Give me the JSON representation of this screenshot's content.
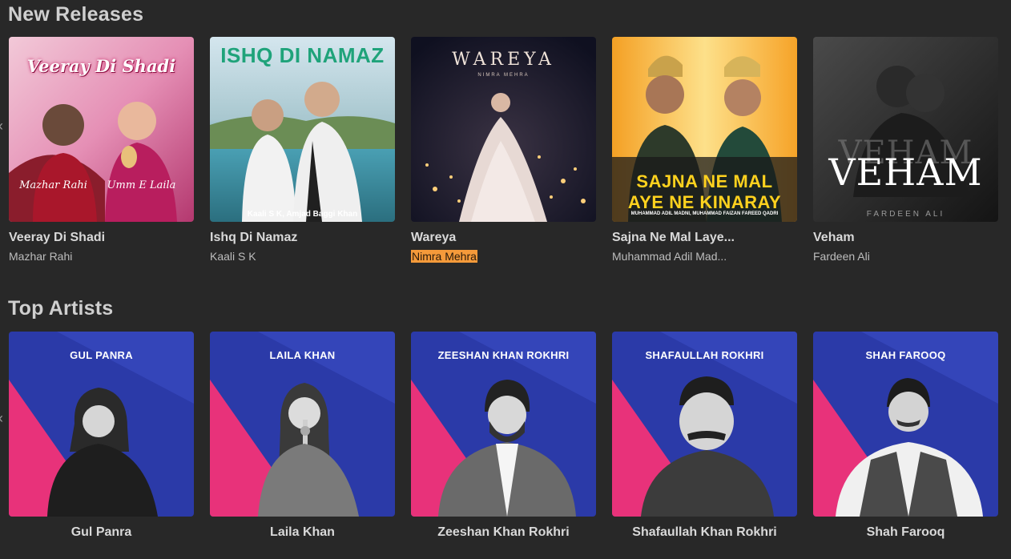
{
  "new_releases": {
    "title": "New Releases",
    "items": [
      {
        "title": "Veeray Di Shadi",
        "artist": "Mazhar Rahi",
        "art_text": "Veeray Di Shadi",
        "art_sub1": "Mazhar Rahi",
        "art_sub2": "Umm E Laila"
      },
      {
        "title": "Ishq Di Namaz",
        "artist": "Kaali S K",
        "art_text": "ISHQ DI NAMAZ",
        "art_sub1": "Kaali S K, Amjad Baggi Khan"
      },
      {
        "title": "Wareya",
        "artist": "Nimra Mehra",
        "art_text": "WAREYA",
        "art_sub1": "NIMRA MEHRA",
        "highlighted": true
      },
      {
        "title": "Sajna Ne Mal Laye...",
        "artist": "Muhammad Adil Mad...",
        "art_text": "SAJNA NE MAL",
        "art_text2": "AYE NE KINARAY",
        "art_sub1": "MUHAMMAD ADIL MADNI, MUHAMMAD FAIZAN FAREED QADRI"
      },
      {
        "title": "Veham",
        "artist": "Fardeen Ali",
        "art_text": "VEHAM",
        "art_sub1": "FARDEEN ALI"
      }
    ]
  },
  "top_artists": {
    "title": "Top Artists",
    "items": [
      {
        "name": "Gul Panra",
        "caption": "GUL PANRA"
      },
      {
        "name": "Laila Khan",
        "caption": "LAILA KHAN"
      },
      {
        "name": "Zeeshan Khan Rokhri",
        "caption": "ZEESHAN KHAN ROKHRI"
      },
      {
        "name": "Shafaullah Khan Rokhri",
        "caption": "SHAFAULLAH ROKHRI"
      },
      {
        "name": "Shah Farooq",
        "caption": "SHAH FAROOQ"
      }
    ]
  },
  "icons": {
    "prev": "chevron-left-icon"
  },
  "colors": {
    "background": "#282828",
    "highlight": "#f59a3a",
    "artist_bg_blue": "#2b3aa8",
    "artist_bg_pink": "#e8327a"
  }
}
